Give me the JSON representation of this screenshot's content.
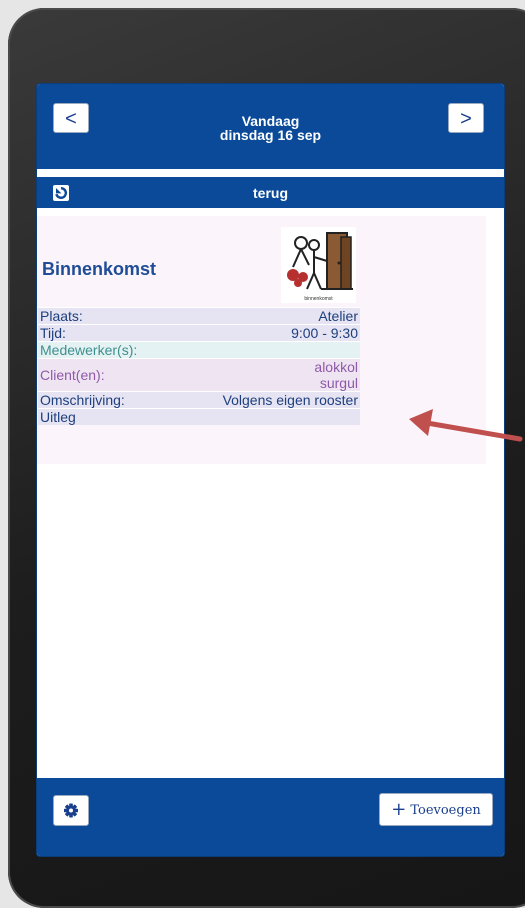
{
  "header": {
    "title_line1": "Vandaag",
    "title_line2": "dinsdag 16 sep",
    "prev_label": "<",
    "next_label": ">"
  },
  "backbar": {
    "label": "terug"
  },
  "event": {
    "title": "Binnenkomst",
    "pictogram_caption": "binnenkomst",
    "details": {
      "location_label": "Plaats:",
      "location_value": "Atelier",
      "time_label": "Tijd:",
      "time_value": "9:00 - 9:30",
      "staff_label": "Medewerker(s):",
      "staff_value": "",
      "clients_label": "Client(en):",
      "clients_value_1": "alokkol",
      "clients_value_2": "surgul",
      "description_label": "Omschrijving:",
      "description_value": "Volgens eigen rooster",
      "explanation_label": "Uitleg",
      "explanation_value": ""
    }
  },
  "footer": {
    "settings_icon": "gear-icon",
    "add_label": "Toevoegen",
    "add_icon": "plus-icon"
  },
  "colors": {
    "primary": "#0b4a99",
    "label_text": "#1d3f7e",
    "staff_text": "#3f8f8e",
    "client_text": "#8e5aa8",
    "annotation_arrow": "#c0504d"
  }
}
